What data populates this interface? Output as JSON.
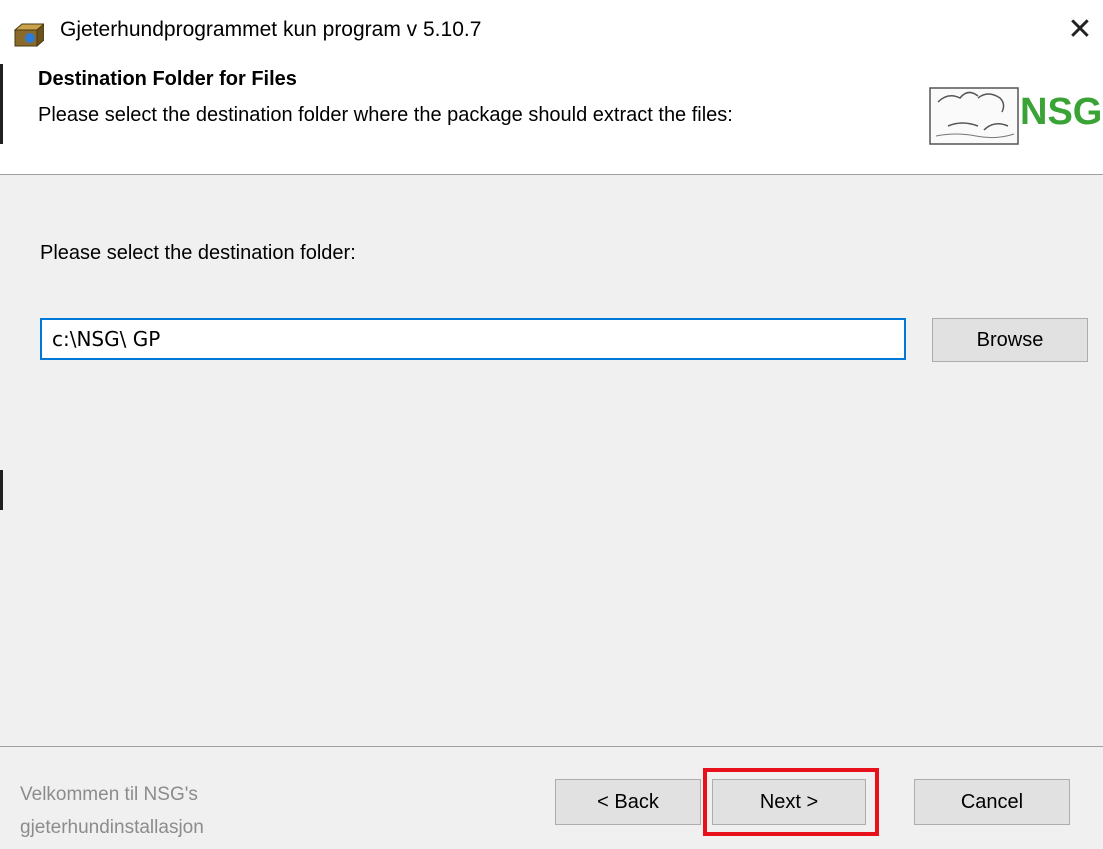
{
  "window": {
    "title": "Gjeterhundprogrammet kun program v 5.10.7",
    "app_icon": "installer-box-icon",
    "close_glyph": "✕"
  },
  "header": {
    "title": "Destination Folder for Files",
    "subtitle": "Please select the destination folder where the package should extract the files:",
    "logo_text": "NSG"
  },
  "main": {
    "prompt": "Please select the destination folder:",
    "path_value": "c:\\NSG\\ GP",
    "browse_label": "Browse"
  },
  "footer": {
    "welcome_line1": "Velkommen til NSG's",
    "welcome_line2": "gjeterhundinstallasjon",
    "back_label": "< Back",
    "next_label": "Next >",
    "cancel_label": "Cancel"
  },
  "colors": {
    "focus_border": "#0078d7",
    "highlight": "#e8111b",
    "logo_green": "#3aa335"
  }
}
